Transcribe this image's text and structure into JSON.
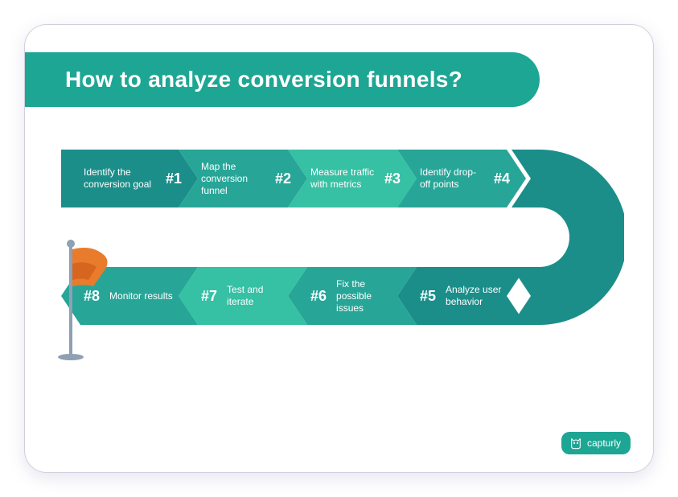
{
  "title": "How to analyze conversion funnels?",
  "steps_top": [
    {
      "num": "#1",
      "label": "Identify the conversion goal",
      "color": "#1b8e8a"
    },
    {
      "num": "#2",
      "label": "Map the conversion funnel",
      "color": "#27a698"
    },
    {
      "num": "#3",
      "label": "Measure traffic with metrics",
      "color": "#36c0a4"
    },
    {
      "num": "#4",
      "label": "Identify drop-off points",
      "color": "#27a698"
    }
  ],
  "steps_bottom": [
    {
      "num": "#5",
      "label": "Analyze user behavior",
      "color": "#1b8e8a"
    },
    {
      "num": "#6",
      "label": "Fix the possible issues",
      "color": "#27a698"
    },
    {
      "num": "#7",
      "label": "Test and iterate",
      "color": "#36c0a4"
    },
    {
      "num": "#8",
      "label": "Monitor results",
      "color": "#27a698"
    }
  ],
  "uturn_color": "#1b8e8a",
  "flag_color": "#e97b2c",
  "brand": "capturly"
}
